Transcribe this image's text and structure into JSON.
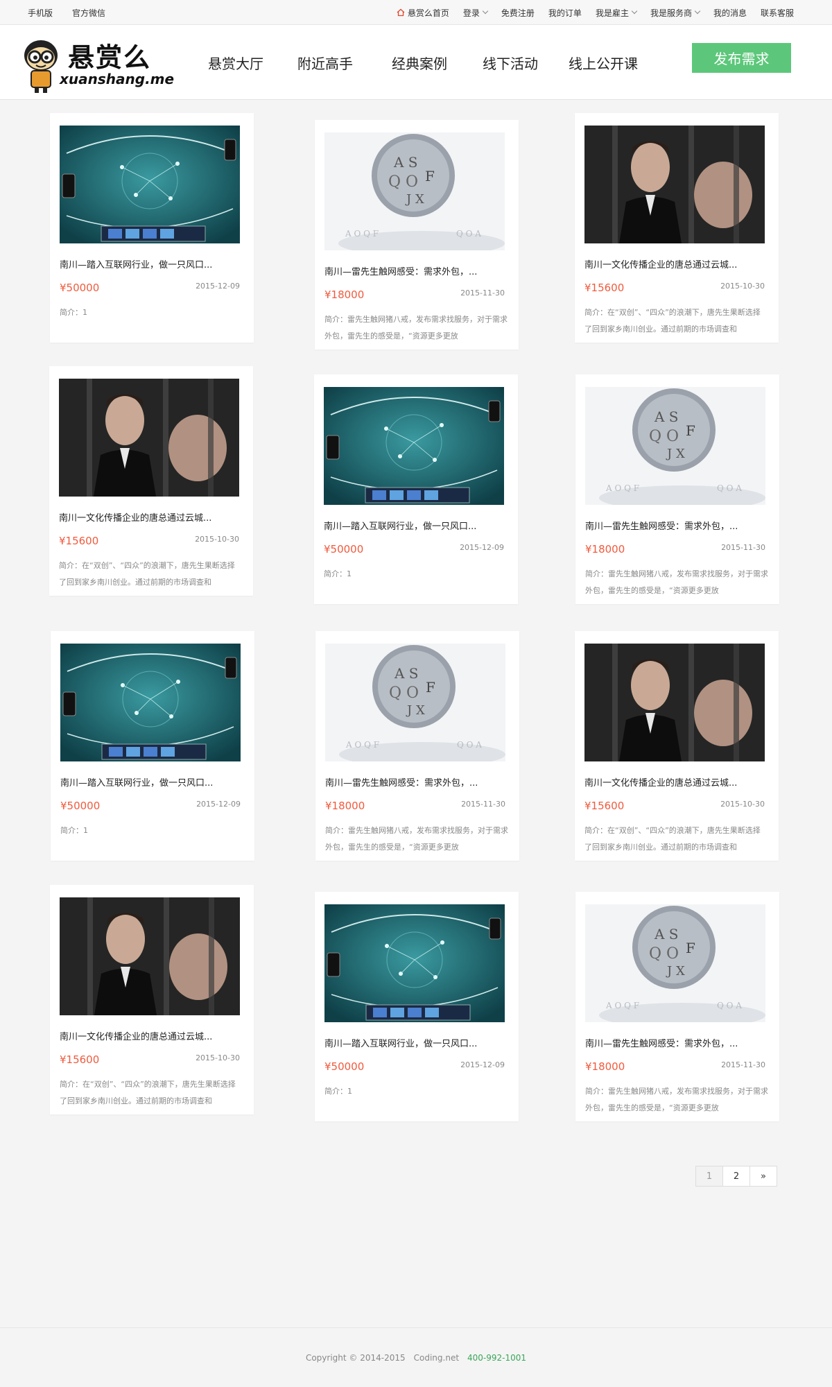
{
  "topbar": {
    "left": [
      "手机版",
      "官方微信"
    ],
    "home": "悬赏么首页",
    "login": "登录",
    "register": "免费注册",
    "orders": "我的订单",
    "employer": "我是雇主",
    "provider": "我是服务商",
    "messages": "我的消息",
    "support": "联系客服"
  },
  "logo": {
    "title": "悬赏么",
    "sub": "xuanshang.me"
  },
  "nav": [
    "悬赏大厅",
    "附近高手",
    "经典案例",
    "线下活动",
    "线上公开课"
  ],
  "publish_label": "发布需求",
  "cards": [
    {
      "title": "南川—踏入互联网行业，做一只风口...",
      "price": "¥50000",
      "date": "2015-12-09",
      "desc": "简介：1",
      "image": "tech-network"
    },
    {
      "title": "南川—雷先生触网感受：需求外包，...",
      "price": "¥18000",
      "date": "2015-11-30",
      "desc": "简介：雷先生触网猪八戒，发布需求找服务，对于需求外包，雷先生的感受是，“资源更多更放",
      "image": "letter-sphere"
    },
    {
      "title": "南川一文化传播企业的唐总通过云城...",
      "price": "¥15600",
      "date": "2015-10-30",
      "desc": "简介：在“双创”、“四众”的浪潮下，唐先生果断选择了回到家乡南川创业。通过前期的市场调查和",
      "image": "man-bars"
    },
    {
      "title": "南川一文化传播企业的唐总通过云城...",
      "price": "¥15600",
      "date": "2015-10-30",
      "desc": "简介：在“双创”、“四众”的浪潮下，唐先生果断选择了回到家乡南川创业。通过前期的市场调查和",
      "image": "man-bars"
    },
    {
      "title": "南川—踏入互联网行业，做一只风口...",
      "price": "¥50000",
      "date": "2015-12-09",
      "desc": "简介：1",
      "image": "tech-network"
    },
    {
      "title": "南川—雷先生触网感受：需求外包，...",
      "price": "¥18000",
      "date": "2015-11-30",
      "desc": "简介：雷先生触网猪八戒，发布需求找服务，对于需求外包，雷先生的感受是，“资源更多更放",
      "image": "letter-sphere"
    },
    {
      "title": "南川—踏入互联网行业，做一只风口...",
      "price": "¥50000",
      "date": "2015-12-09",
      "desc": "简介：1",
      "image": "tech-network"
    },
    {
      "title": "南川—雷先生触网感受：需求外包，...",
      "price": "¥18000",
      "date": "2015-11-30",
      "desc": "简介：雷先生触网猪八戒，发布需求找服务，对于需求外包，雷先生的感受是，“资源更多更放",
      "image": "letter-sphere"
    },
    {
      "title": "南川一文化传播企业的唐总通过云城...",
      "price": "¥15600",
      "date": "2015-10-30",
      "desc": "简介：在“双创”、“四众”的浪潮下，唐先生果断选择了回到家乡南川创业。通过前期的市场调查和",
      "image": "man-bars"
    },
    {
      "title": "南川一文化传播企业的唐总通过云城...",
      "price": "¥15600",
      "date": "2015-10-30",
      "desc": "简介：在“双创”、“四众”的浪潮下，唐先生果断选择了回到家乡南川创业。通过前期的市场调查和",
      "image": "man-bars"
    },
    {
      "title": "南川—踏入互联网行业，做一只风口...",
      "price": "¥50000",
      "date": "2015-12-09",
      "desc": "简介：1",
      "image": "tech-network"
    },
    {
      "title": "南川—雷先生触网感受：需求外包，...",
      "price": "¥18000",
      "date": "2015-11-30",
      "desc": "简介：雷先生触网猪八戒，发布需求找服务，对于需求外包，雷先生的感受是，“资源更多更放",
      "image": "letter-sphere"
    }
  ],
  "pagination": [
    "1",
    "2",
    "»"
  ],
  "footer": {
    "copyright": "Copyright © 2014-2015",
    "site": "Coding.net",
    "phone": "400-992-1001"
  }
}
